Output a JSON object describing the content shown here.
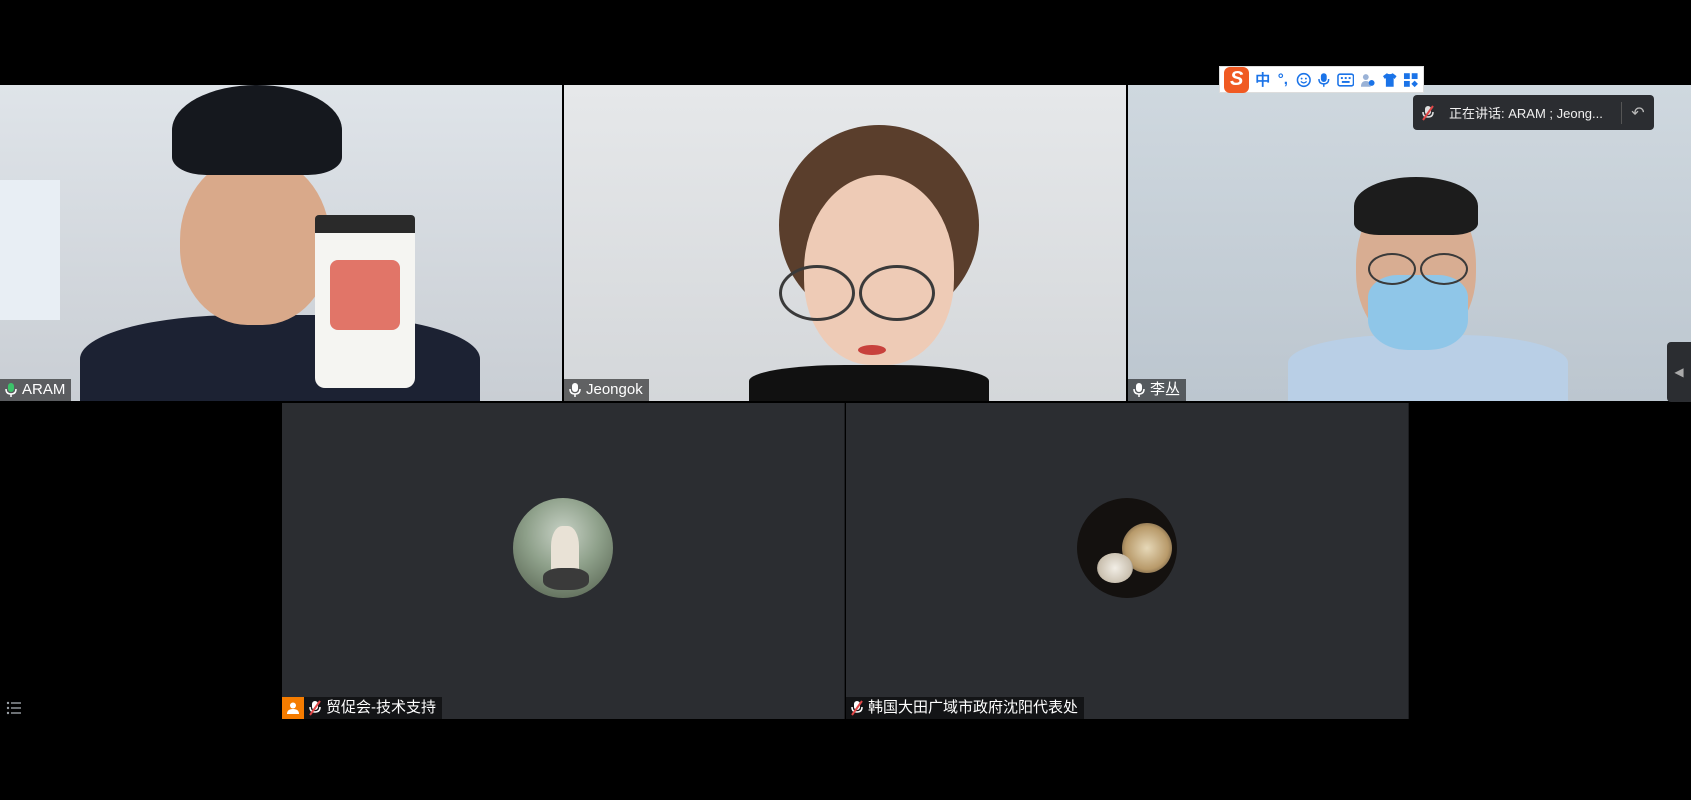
{
  "participants": [
    {
      "name": "ARAM",
      "mic": "active"
    },
    {
      "name": "Jeongok",
      "mic": "on"
    },
    {
      "name": "李丛",
      "mic": "on"
    },
    {
      "name": "贸促会-技术支持",
      "mic": "muted",
      "host": true
    },
    {
      "name": "韩国大田广域市政府沈阳代表处",
      "mic": "muted"
    }
  ],
  "speaking": {
    "text": "正在讲话: ARAM ; Jeong..."
  },
  "ime": {
    "logo": "S",
    "mode": "中",
    "punct": "°,",
    "items": [
      "emoji-icon",
      "mic-icon",
      "keyboard-icon",
      "user-icon",
      "shirt-icon",
      "grid-icon"
    ]
  },
  "colors": {
    "active_border": "#2f9e57",
    "mic_green": "#3cc26a",
    "muted_red": "#e04848",
    "host_orange": "#f57c00"
  }
}
